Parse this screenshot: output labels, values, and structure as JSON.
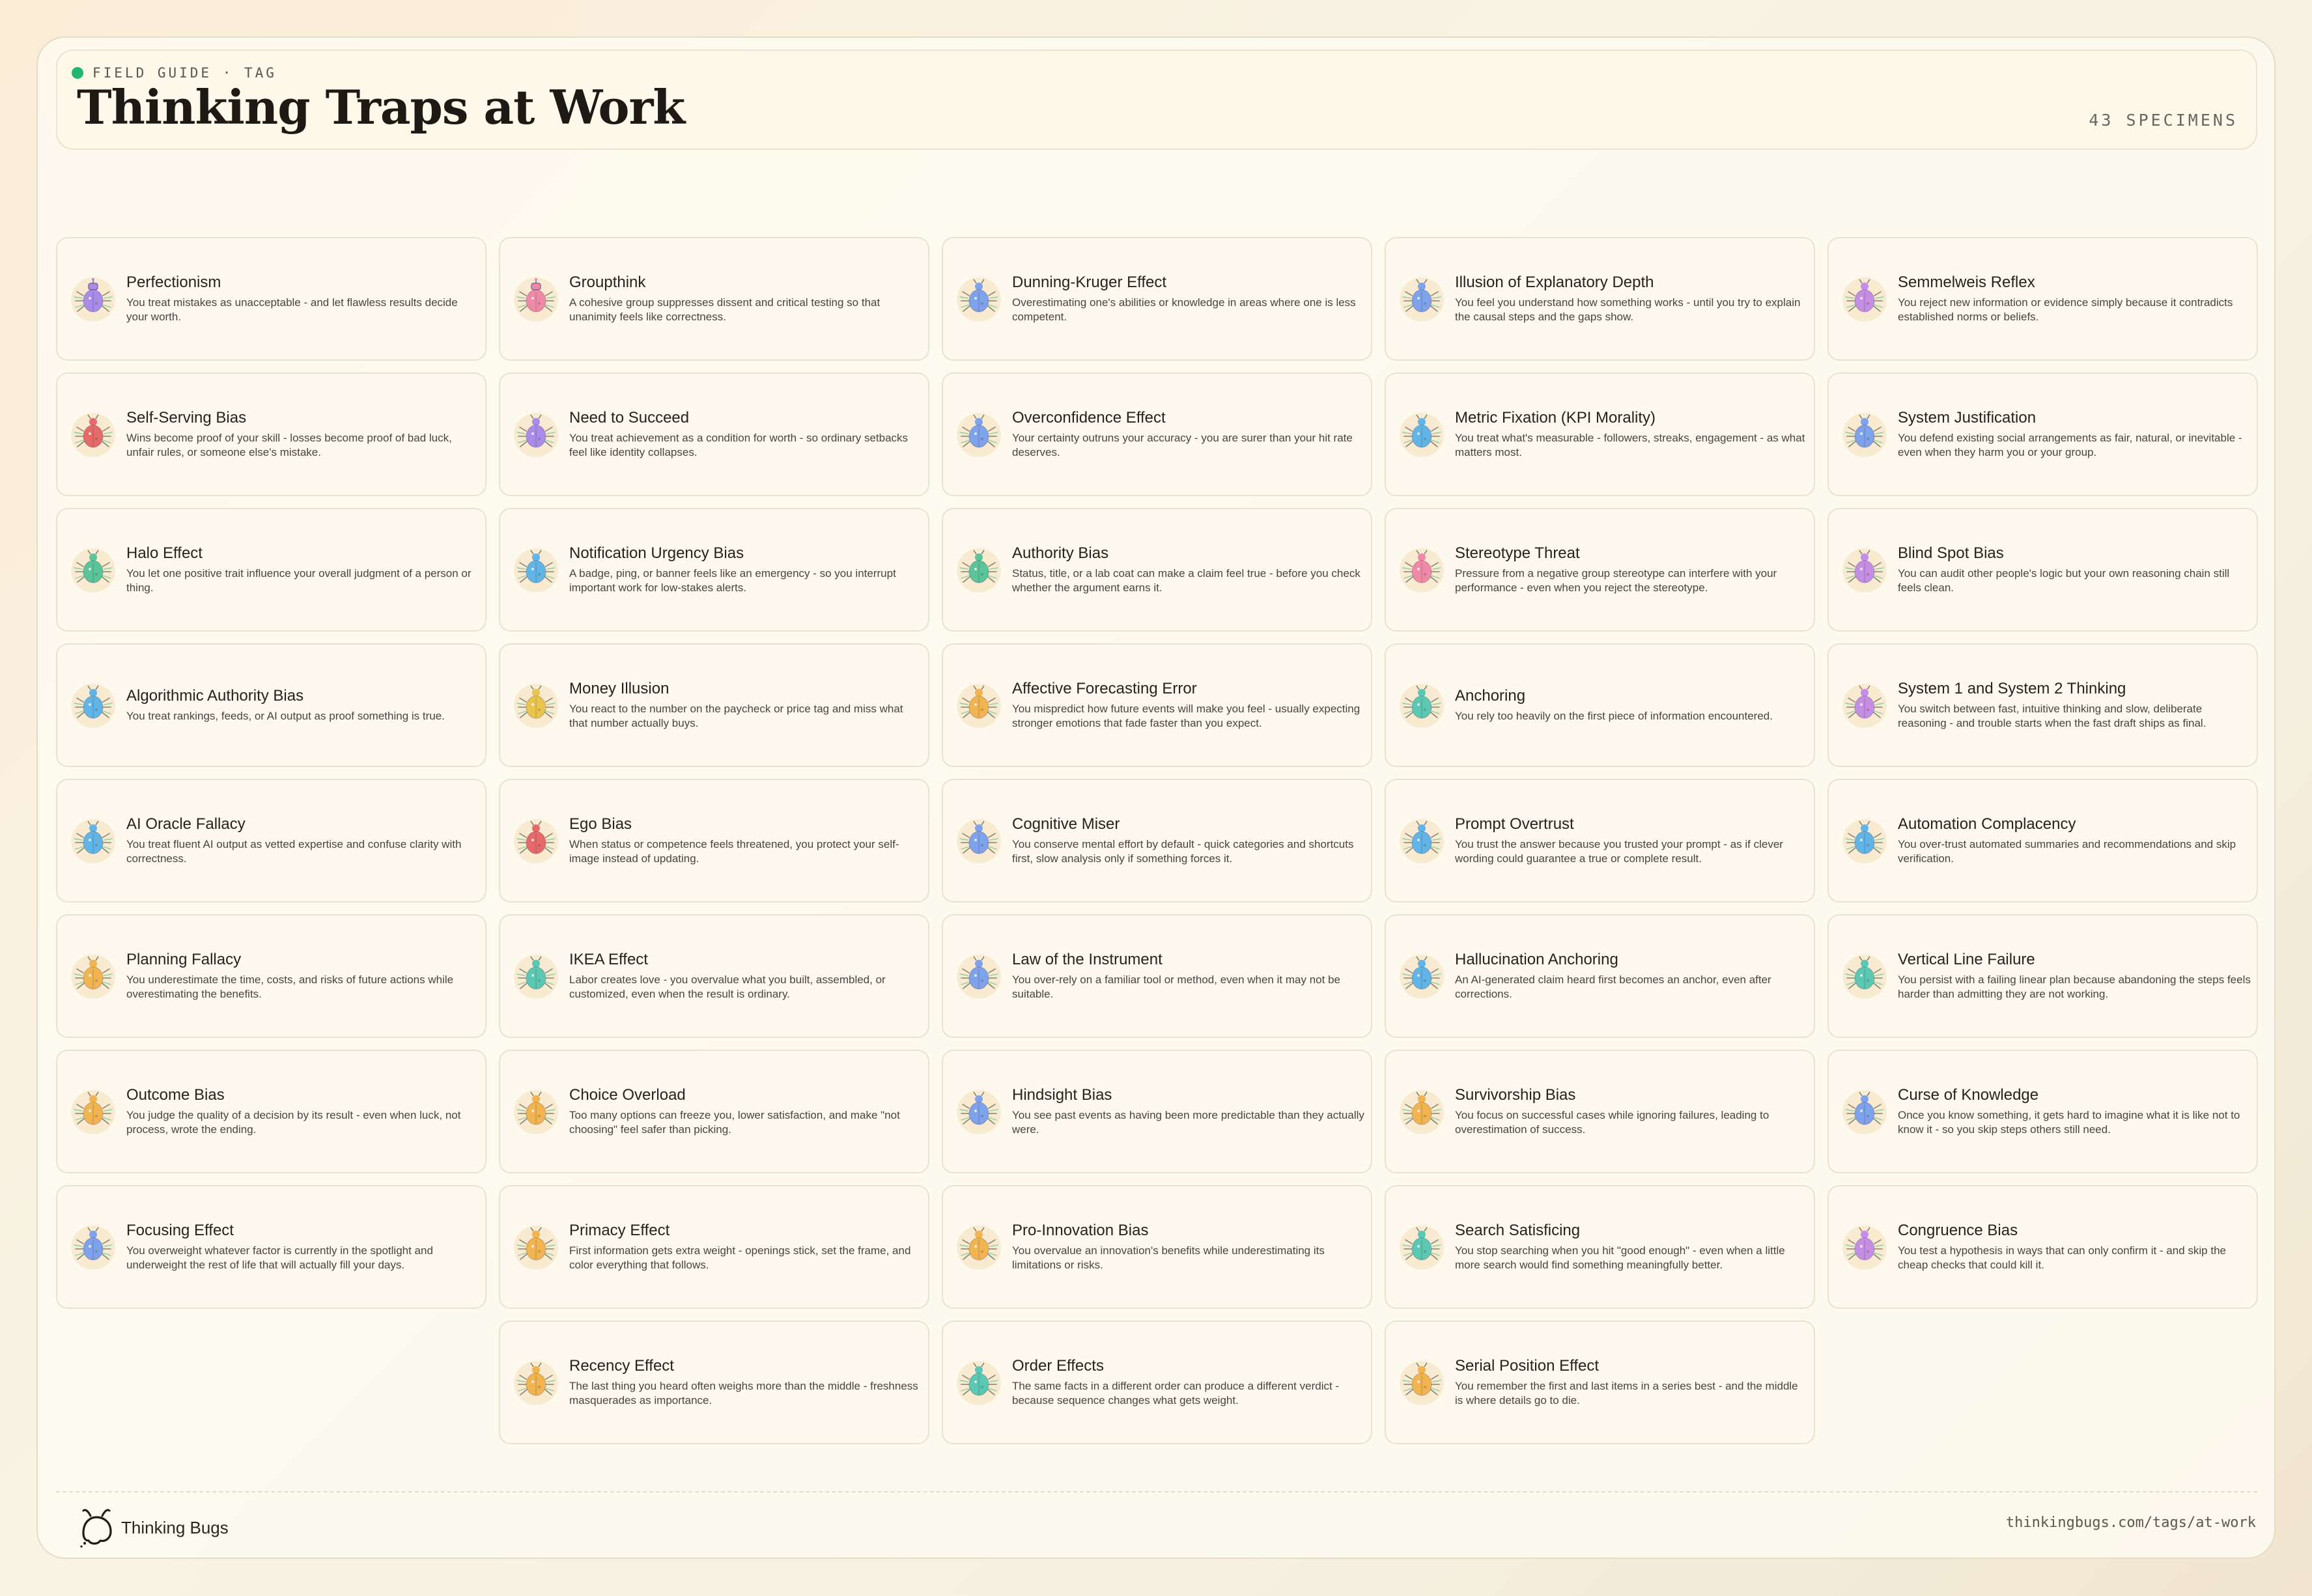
{
  "header": {
    "kicker": "FIELD GUIDE · TAG",
    "title": "Thinking Traps at Work",
    "count": "43 SPECIMENS"
  },
  "footer": {
    "brand": "Thinking Bugs",
    "url": "thinkingbugs.com/tags/at-work"
  },
  "colors": {
    "accent_dot": "#21b573",
    "purple": "#a98be8",
    "pink": "#ee8aa8",
    "blue": "#7fa3ea",
    "violet": "#c38ee3",
    "red": "#e56b6b",
    "green": "#5cc49a",
    "sky": "#62b3e6",
    "yellow": "#e9c44f",
    "orange": "#f2b452",
    "teal": "#5cc8b4"
  },
  "cards": [
    {
      "name": "Perfectionism",
      "desc": "You treat mistakes as unacceptable - and let flawless results decide your worth.",
      "icon": "purple-robot-bug-icon",
      "color": "purple"
    },
    {
      "name": "Groupthink",
      "desc": "A cohesive group suppresses dissent and critical testing so that unanimity feels like correctness.",
      "icon": "pink-robot-bug-icon",
      "color": "pink"
    },
    {
      "name": "Dunning-Kruger Effect",
      "desc": "Overestimating one's abilities or knowledge in areas where one is less competent.",
      "icon": "blue-bug-icon",
      "color": "blue"
    },
    {
      "name": "Illusion of Explanatory Depth",
      "desc": "You feel you understand how something works - until you try to explain the causal steps and the gaps show.",
      "icon": "blue-bug-icon",
      "color": "blue"
    },
    {
      "name": "Semmelweis Reflex",
      "desc": "You reject new information or evidence simply because it contradicts established norms or beliefs.",
      "icon": "violet-bug-icon",
      "color": "violet"
    },
    {
      "name": "Self-Serving Bias",
      "desc": "Wins become proof of your skill - losses become proof of bad luck, unfair rules, or someone else's mistake.",
      "icon": "red-bug-icon",
      "color": "red"
    },
    {
      "name": "Need to Succeed",
      "desc": "You treat achievement as a condition for worth - so ordinary setbacks feel like identity collapses.",
      "icon": "purple-bug-icon",
      "color": "purple"
    },
    {
      "name": "Overconfidence Effect",
      "desc": "Your certainty outruns your accuracy - you are surer than your hit rate deserves.",
      "icon": "blue-bug-icon",
      "color": "blue"
    },
    {
      "name": "Metric Fixation (KPI Morality)",
      "desc": "You treat what's measurable - followers, streaks, engagement - as what matters most.",
      "icon": "sky-bug-icon",
      "color": "sky"
    },
    {
      "name": "System Justification",
      "desc": "You defend existing social arrangements as fair, natural, or inevitable - even when they harm you or your group.",
      "icon": "blue-bug-icon",
      "color": "blue"
    },
    {
      "name": "Halo Effect",
      "desc": "You let one positive trait influence your overall judgment of a person or thing.",
      "icon": "green-bug-icon",
      "color": "green"
    },
    {
      "name": "Notification Urgency Bias",
      "desc": "A badge, ping, or banner feels like an emergency - so you interrupt important work for low-stakes alerts.",
      "icon": "sky-bug-icon",
      "color": "sky"
    },
    {
      "name": "Authority Bias",
      "desc": "Status, title, or a lab coat can make a claim feel true - before you check whether the argument earns it.",
      "icon": "green-bug-icon",
      "color": "green"
    },
    {
      "name": "Stereotype Threat",
      "desc": "Pressure from a negative group stereotype can interfere with your performance - even when you reject the stereotype.",
      "icon": "pink-bug-icon",
      "color": "pink"
    },
    {
      "name": "Blind Spot Bias",
      "desc": "You can audit other people's logic but your own reasoning chain still feels clean.",
      "icon": "violet-bug-icon",
      "color": "violet"
    },
    {
      "name": "Algorithmic Authority Bias",
      "desc": "You treat rankings, feeds, or AI output as proof something is true.",
      "icon": "sky-bug-icon",
      "color": "sky"
    },
    {
      "name": "Money Illusion",
      "desc": "You react to the number on the paycheck or price tag and miss what that number actually buys.",
      "icon": "yellow-bug-icon",
      "color": "yellow"
    },
    {
      "name": "Affective Forecasting Error",
      "desc": "You mispredict how future events will make you feel - usually expecting stronger emotions that fade faster than you expect.",
      "icon": "orange-bug-icon",
      "color": "orange"
    },
    {
      "name": "Anchoring",
      "desc": "You rely too heavily on the first piece of information encountered.",
      "icon": "teal-bug-icon",
      "color": "teal"
    },
    {
      "name": "System 1 and System 2 Thinking",
      "desc": "You switch between fast, intuitive thinking and slow, deliberate reasoning - and trouble starts when the fast draft ships as final.",
      "icon": "violet-bug-icon",
      "color": "violet"
    },
    {
      "name": "AI Oracle Fallacy",
      "desc": "You treat fluent AI output as vetted expertise and confuse clarity with correctness.",
      "icon": "sky-bug-icon",
      "color": "sky"
    },
    {
      "name": "Ego Bias",
      "desc": "When status or competence feels threatened, you protect your self-image instead of updating.",
      "icon": "red-bug-icon",
      "color": "red"
    },
    {
      "name": "Cognitive Miser",
      "desc": "You conserve mental effort by default - quick categories and shortcuts first, slow analysis only if something forces it.",
      "icon": "blue-bug-icon",
      "color": "blue"
    },
    {
      "name": "Prompt Overtrust",
      "desc": "You trust the answer because you trusted your prompt - as if clever wording could guarantee a true or complete result.",
      "icon": "sky-bug-icon",
      "color": "sky"
    },
    {
      "name": "Automation Complacency",
      "desc": "You over-trust automated summaries and recommendations and skip verification.",
      "icon": "sky-bug-icon",
      "color": "sky"
    },
    {
      "name": "Planning Fallacy",
      "desc": "You underestimate the time, costs, and risks of future actions while overestimating the benefits.",
      "icon": "orange-bug-icon",
      "color": "orange"
    },
    {
      "name": "IKEA Effect",
      "desc": "Labor creates love - you overvalue what you built, assembled, or customized, even when the result is ordinary.",
      "icon": "teal-bug-icon",
      "color": "teal"
    },
    {
      "name": "Law of the Instrument",
      "desc": "You over-rely on a familiar tool or method, even when it may not be suitable.",
      "icon": "blue-bug-icon",
      "color": "blue"
    },
    {
      "name": "Hallucination Anchoring",
      "desc": "An AI-generated claim heard first becomes an anchor, even after corrections.",
      "icon": "sky-bug-icon",
      "color": "sky"
    },
    {
      "name": "Vertical Line Failure",
      "desc": "You persist with a failing linear plan because abandoning the steps feels harder than admitting they are not working.",
      "icon": "teal-bug-icon",
      "color": "teal"
    },
    {
      "name": "Outcome Bias",
      "desc": "You judge the quality of a decision by its result - even when luck, not process, wrote the ending.",
      "icon": "orange-bug-icon",
      "color": "orange"
    },
    {
      "name": "Choice Overload",
      "desc": "Too many options can freeze you, lower satisfaction, and make \"not choosing\" feel safer than picking.",
      "icon": "orange-bug-icon",
      "color": "orange"
    },
    {
      "name": "Hindsight Bias",
      "desc": "You see past events as having been more predictable than they actually were.",
      "icon": "blue-bug-icon",
      "color": "blue"
    },
    {
      "name": "Survivorship Bias",
      "desc": "You focus on successful cases while ignoring failures, leading to overestimation of success.",
      "icon": "orange-bug-icon",
      "color": "orange"
    },
    {
      "name": "Curse of Knowledge",
      "desc": "Once you know something, it gets hard to imagine what it is like not to know it - so you skip steps others still need.",
      "icon": "blue-bug-icon",
      "color": "blue"
    },
    {
      "name": "Focusing Effect",
      "desc": "You overweight whatever factor is currently in the spotlight and underweight the rest of life that will actually fill your days.",
      "icon": "blue-bug-icon",
      "color": "blue"
    },
    {
      "name": "Primacy Effect",
      "desc": "First information gets extra weight - openings stick, set the frame, and color everything that follows.",
      "icon": "orange-bug-icon",
      "color": "orange"
    },
    {
      "name": "Pro-Innovation Bias",
      "desc": "You overvalue an innovation's benefits while underestimating its limitations or risks.",
      "icon": "orange-bug-icon",
      "color": "orange"
    },
    {
      "name": "Search Satisficing",
      "desc": "You stop searching when you hit \"good enough\" - even when a little more search would find something meaningfully better.",
      "icon": "teal-bug-icon",
      "color": "teal"
    },
    {
      "name": "Congruence Bias",
      "desc": "You test a hypothesis in ways that can only confirm it - and skip the cheap checks that could kill it.",
      "icon": "violet-bug-icon",
      "color": "violet"
    },
    {
      "name": "Recency Effect",
      "desc": "The last thing you heard often weighs more than the middle - freshness masquerades as importance.",
      "icon": "orange-bug-icon",
      "color": "orange"
    },
    {
      "name": "Order Effects",
      "desc": "The same facts in a different order can produce a different verdict - because sequence changes what gets weight.",
      "icon": "teal-bug-icon",
      "color": "teal"
    },
    {
      "name": "Serial Position Effect",
      "desc": "You remember the first and last items in a series best - and the middle is where details go to die.",
      "icon": "orange-bug-icon",
      "color": "orange"
    }
  ]
}
